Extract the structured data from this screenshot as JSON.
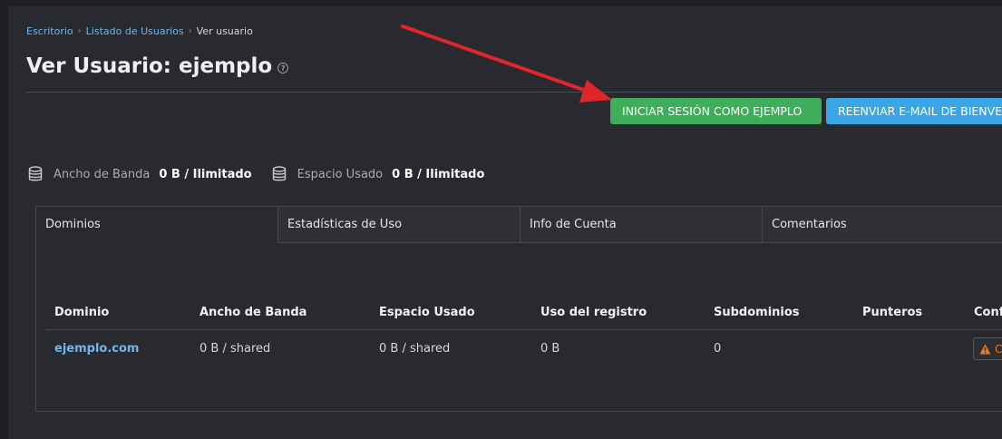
{
  "breadcrumb": {
    "items": [
      "Escritorio",
      "Listado de Usuarios"
    ],
    "current": "Ver usuario"
  },
  "page": {
    "title": "Ver Usuario: ejemplo"
  },
  "actions": {
    "login_as": "INICIAR SESIÓN COMO EJEMPLO",
    "resend_email": "REENVIAR E-MAIL DE BIENVENIDA"
  },
  "usage": {
    "bandwidth_label": "Ancho de Banda",
    "bandwidth_value": "0 B / Ilimitado",
    "disk_label": "Espacio Usado",
    "disk_value": "0 B / Ilimitado"
  },
  "tabs": [
    "Dominios",
    "Estadísticas de Uso",
    "Info de Cuenta",
    "Comentarios"
  ],
  "table": {
    "headers": [
      "Dominio",
      "Ancho de Banda",
      "Espacio Usado",
      "Uso del registro",
      "Subdominios",
      "Punteros",
      "Config"
    ],
    "rows": [
      {
        "domain": "ejemplo.com",
        "bandwidth": "0 B / shared",
        "disk": "0 B / shared",
        "log_usage": "0 B",
        "subdomains": "0",
        "pointers": "",
        "config_label": "C"
      }
    ]
  },
  "colors": {
    "background": "#1e1f22",
    "panel": "#292a2f",
    "link": "#6fb6ea",
    "login_button": "#3fae5a",
    "resend_button": "#3aa6e6",
    "warning": "#ee7a1a",
    "arrow": "#e0262b"
  },
  "icons": {
    "help": "question-circle-icon",
    "usage": "database-icon",
    "config_warning": "warning-triangle-icon",
    "breadcrumb_separator": "chevron-right-icon"
  }
}
